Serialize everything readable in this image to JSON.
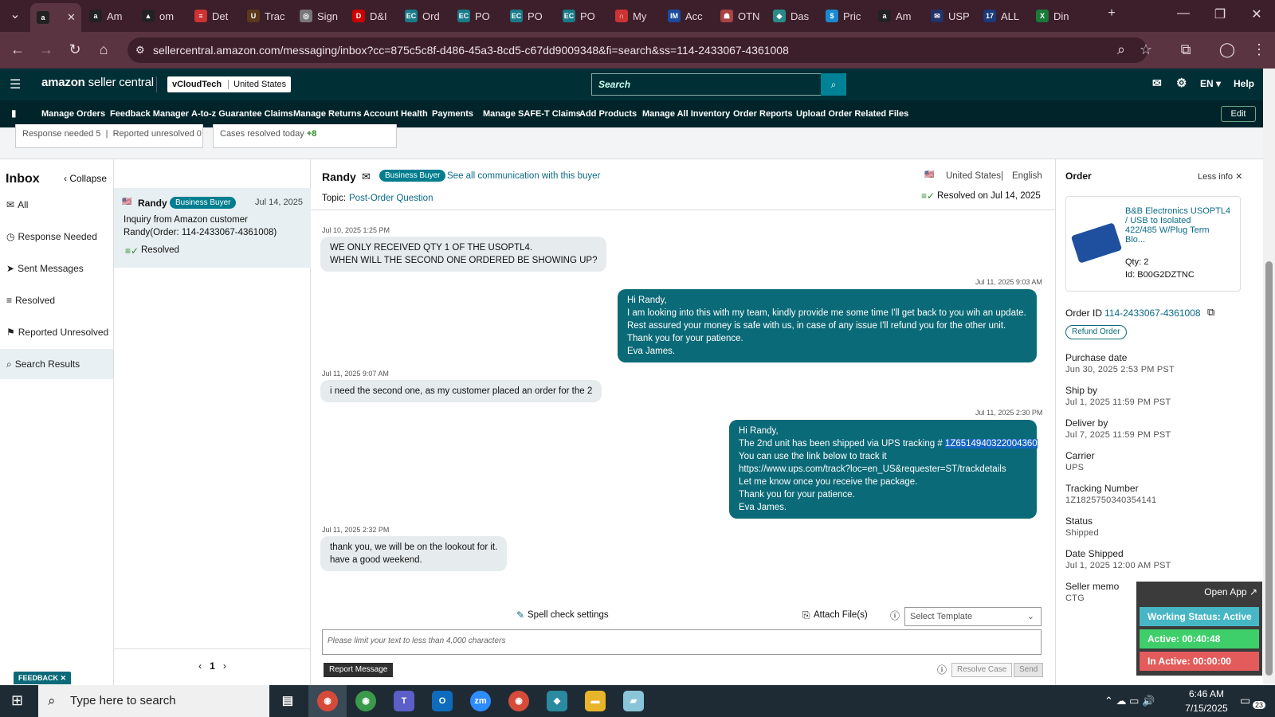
{
  "browser": {
    "tabs": [
      {
        "label": "",
        "icon": "a",
        "color": "#222"
      },
      {
        "label": "Am",
        "icon": "a",
        "color": "#222"
      },
      {
        "label": "om",
        "icon": "▲",
        "color": "#222"
      },
      {
        "label": "Det",
        "icon": "≡",
        "color": "#c33"
      },
      {
        "label": "Trac",
        "icon": "U",
        "color": "#5a3a1a"
      },
      {
        "label": "Sign",
        "icon": "◎",
        "color": "#777"
      },
      {
        "label": "D&I",
        "icon": "D",
        "color": "#c00"
      },
      {
        "label": "Ord",
        "icon": "EC",
        "color": "#1a7a8a"
      },
      {
        "label": "PO",
        "icon": "EC",
        "color": "#1a7a8a"
      },
      {
        "label": "PO",
        "icon": "EC",
        "color": "#1a7a8a"
      },
      {
        "label": "PO",
        "icon": "EC",
        "color": "#1a7a8a"
      },
      {
        "label": "My",
        "icon": "∩",
        "color": "#c33"
      },
      {
        "label": "Acc",
        "icon": "IM",
        "color": "#1a4ba0"
      },
      {
        "label": "OTN",
        "icon": "☗",
        "color": "#a44"
      },
      {
        "label": "Das",
        "icon": "◆",
        "color": "#2a8a8a"
      },
      {
        "label": "Pric",
        "icon": "$",
        "color": "#1a8ad0"
      },
      {
        "label": "Am",
        "icon": "a",
        "color": "#222"
      },
      {
        "label": "USP",
        "icon": "✉",
        "color": "#22336a"
      },
      {
        "label": "ALL",
        "icon": "17",
        "color": "#1a3a7a"
      },
      {
        "label": "Din",
        "icon": "X",
        "color": "#1a7a3a"
      }
    ],
    "url": "sellercentral.amazon.com/messaging/inbox?cc=875c5c8f-d486-45a3-8cd5-c67dd9009348&fi=search&ss=114-2433067-4361008"
  },
  "header": {
    "logo_main": "amazon",
    "logo_sub": "seller central",
    "store": "vCloudTech",
    "marketplace": "United States",
    "search_placeholder": "Search",
    "lang": "EN",
    "help": "Help"
  },
  "menu": [
    "Manage Orders",
    "Feedback Manager",
    "A-to-z Guarantee Claims",
    "Manage Returns",
    "Account Health",
    "Payments",
    "Manage SAFE-T Claims",
    "Add Products",
    "Manage All Inventory",
    "Order Reports",
    "Upload Order Related Files"
  ],
  "menu_edit": "Edit",
  "stats": {
    "response_needed": "Response needed 5",
    "reported_unresolved": "Reported unresolved 0",
    "cases_resolved": "Cases resolved today",
    "cases_resolved_count": "+8"
  },
  "leftnav": {
    "title": "Inbox",
    "collapse": "Collapse",
    "items": [
      "All",
      "Response Needed",
      "Sent Messages",
      "Resolved",
      "Reported Unresolved",
      "Search Results"
    ]
  },
  "conversation": {
    "name": "Randy",
    "badge": "Business Buyer",
    "date": "Jul 14, 2025",
    "line1": "Inquiry from Amazon customer",
    "line2": "Randy(Order: 114-2433067-4361008)",
    "status": "Resolved",
    "page": "1"
  },
  "chat": {
    "buyer": "Randy",
    "badge": "Business Buyer",
    "see_all": "See all communication with this buyer",
    "country": "United States",
    "language": "English",
    "topic_label": "Topic:",
    "topic": "Post-Order Question",
    "resolved": "Resolved on Jul 14, 2025",
    "messages": [
      {
        "time": "Jul 10, 2025 1:25 PM",
        "lines": [
          "WE ONLY RECEIVED QTY 1 OF THE USOPTL4.",
          "WHEN WILL THE SECOND ONE ORDERED BE SHOWING UP?"
        ]
      },
      {
        "time": "Jul 11, 2025 9:03 AM",
        "lines": [
          "Hi Randy,",
          "I am looking into this with my team,  kindly provide me some time I'll get back to you wih an update.",
          "Rest assured your money is safe with us, in case of any issue I'll refund you for the other unit.",
          "Thank you for your patience.",
          "Eva James."
        ]
      },
      {
        "time": "Jul 11, 2025 9:07 AM",
        "lines": [
          "i need the second one, as my customer placed an order for the 2"
        ]
      },
      {
        "time": "Jul 11, 2025 2:30 PM",
        "lines": [
          "Hi Randy,",
          "The 2nd unit has been shipped via UPS tracking #",
          "You can use the link below to track it",
          "https://www.ups.com/track?loc=en_US&requester=ST/trackdetails",
          "Let me know once you receive the package.",
          "Thank you for your patience.",
          "Eva James."
        ],
        "tracking": "1Z6514940322004360"
      },
      {
        "time": "Jul 11, 2025 2:32 PM",
        "lines": [
          "thank you, we will be on the lookout for it.",
          "have a good weekend."
        ]
      }
    ],
    "spell_check": "Spell check settings",
    "attach": "Attach File(s)",
    "template": "Select Template",
    "composer_placeholder": "Please limit your text to less than 4,000 characters",
    "report": "Report Message",
    "resolve": "Resolve Case",
    "send": "Send"
  },
  "order": {
    "title": "Order",
    "less_info": "Less info",
    "product_name": [
      "B&B Electronics USOPTL4",
      "/ USB to Isolated",
      "422/485 W/Plug Term",
      "Blo..."
    ],
    "qty": "Qty: 2",
    "id_label": "Id: B00G2DZTNC",
    "order_id_label": "Order ID",
    "order_id": "114-2433067-4361008",
    "refund": "Refund Order",
    "fields": [
      {
        "label": "Purchase date",
        "value": "Jun 30, 2025 2:53 PM PST"
      },
      {
        "label": "Ship by",
        "value": "Jul 1, 2025 11:59 PM PST"
      },
      {
        "label": "Deliver by",
        "value": "Jul 7, 2025 11:59 PM PST"
      },
      {
        "label": "Carrier",
        "value": "UPS"
      },
      {
        "label": "Tracking Number",
        "value": "1Z1825750340354141"
      },
      {
        "label": "Status",
        "value": "Shipped"
      },
      {
        "label": "Date Shipped",
        "value": "Jul 1, 2025 12:00 AM PST"
      },
      {
        "label": "Seller memo",
        "value": "CTG"
      }
    ]
  },
  "workstatus": {
    "open_app": "Open App",
    "status": "Working Status: Active",
    "active": "Active: 00:40:48",
    "inactive": "In Active: 00:00:00"
  },
  "feedback": "FEEDBACK",
  "taskbar": {
    "search": "Type here to search",
    "time": "6:46 AM",
    "date": "7/15/2025",
    "notif": "23"
  }
}
